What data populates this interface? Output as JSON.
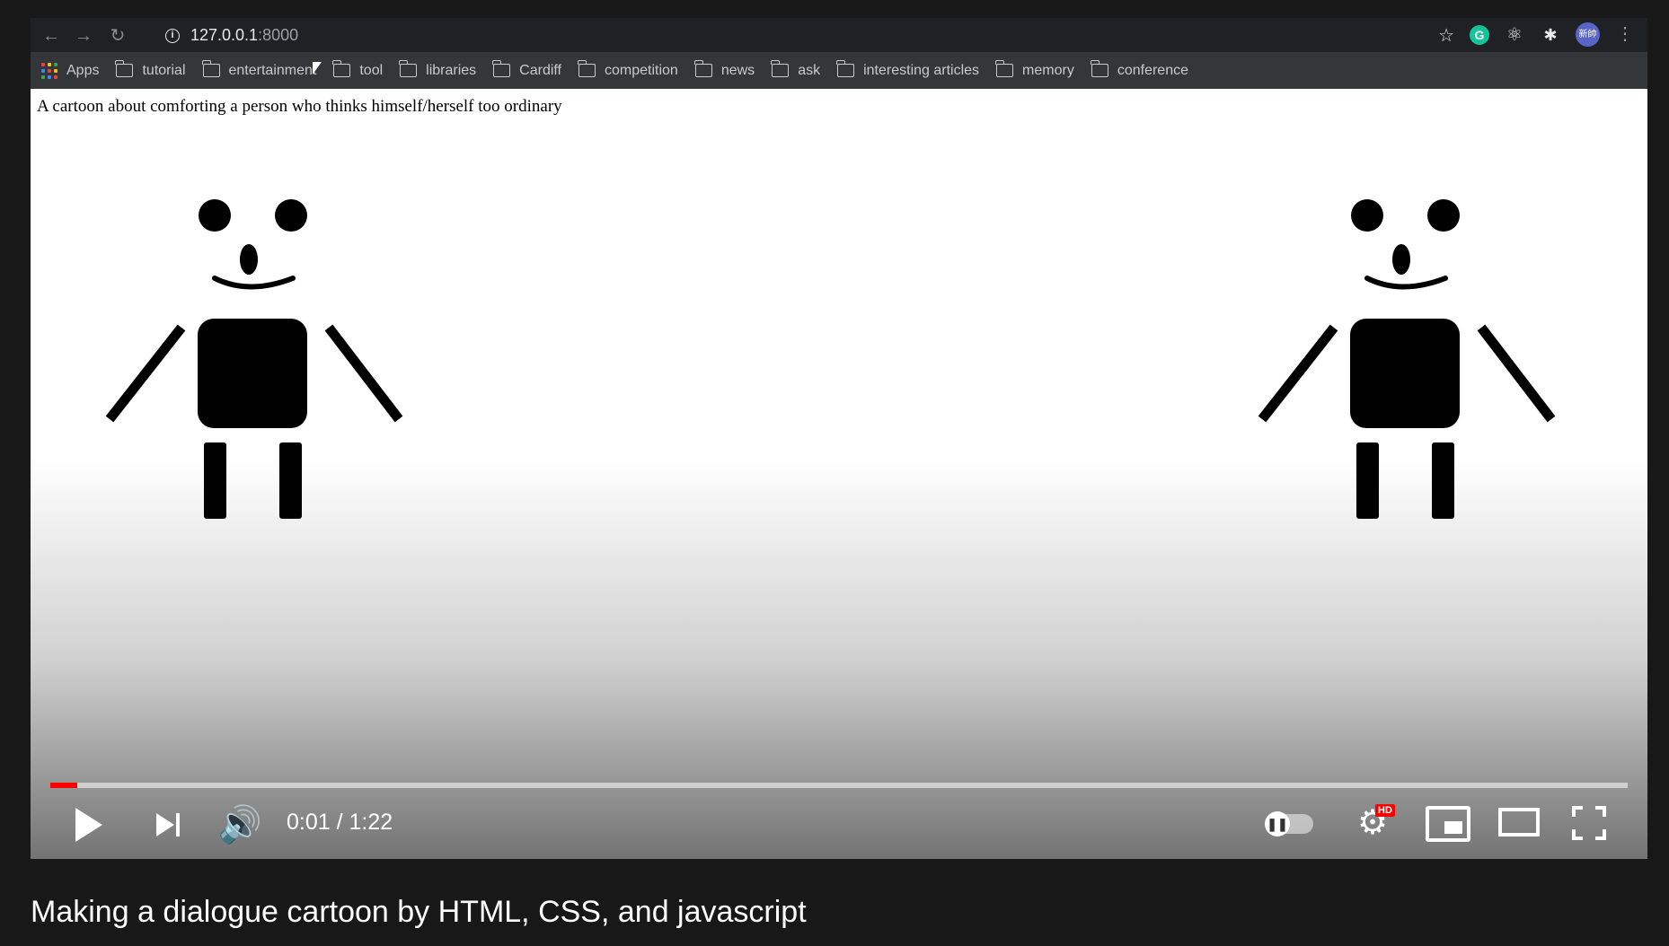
{
  "browser": {
    "url_host": "127.0.0.1",
    "url_port": ":8000",
    "bookmarks": [
      {
        "label": "Apps",
        "icon": "apps-grid-icon"
      },
      {
        "label": "tutorial",
        "icon": "folder-icon"
      },
      {
        "label": "entertainment",
        "icon": "folder-icon"
      },
      {
        "label": "tool",
        "icon": "folder-icon"
      },
      {
        "label": "libraries",
        "icon": "folder-icon"
      },
      {
        "label": "Cardiff",
        "icon": "folder-icon"
      },
      {
        "label": "competition",
        "icon": "folder-icon"
      },
      {
        "label": "news",
        "icon": "folder-icon"
      },
      {
        "label": "ask",
        "icon": "folder-icon"
      },
      {
        "label": "interesting articles",
        "icon": "folder-icon"
      },
      {
        "label": "memory",
        "icon": "folder-icon"
      },
      {
        "label": "conference",
        "icon": "folder-icon"
      }
    ],
    "extensions": {
      "grammarly": "G",
      "avatar": "新帥"
    }
  },
  "web_content": {
    "caption": "A cartoon about comforting a person who thinks himself/herself too ordinary"
  },
  "player": {
    "time": "0:01 / 1:22",
    "progress": 0.017,
    "hd_badge": "HD",
    "accent": "#ff0000"
  },
  "video_title": "Making a dialogue cartoon by HTML, CSS, and javascript"
}
